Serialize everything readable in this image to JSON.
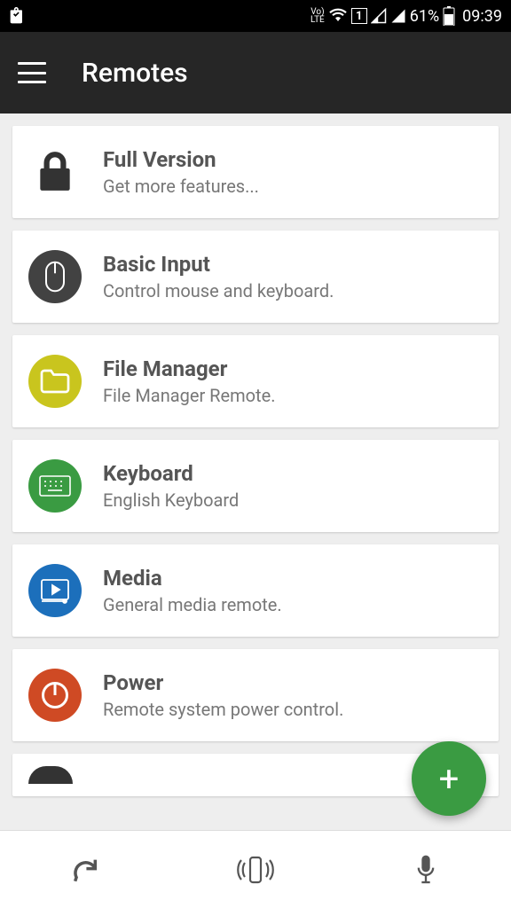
{
  "status": {
    "lte": "Vo)\nLTE",
    "sim": "1",
    "battery": "61%",
    "time": "09:39"
  },
  "header": {
    "title": "Remotes"
  },
  "remotes": [
    {
      "id": "full-version",
      "title": "Full Version",
      "subtitle": "Get more features...",
      "icon": "lock",
      "iconBg": "transparent",
      "iconPlain": true
    },
    {
      "id": "basic-input",
      "title": "Basic Input",
      "subtitle": "Control mouse and keyboard.",
      "icon": "mouse",
      "iconBg": "#424242"
    },
    {
      "id": "file-manager",
      "title": "File Manager",
      "subtitle": "File Manager Remote.",
      "icon": "folder",
      "iconBg": "#c9c51e"
    },
    {
      "id": "keyboard",
      "title": "Keyboard",
      "subtitle": "English Keyboard",
      "icon": "keyboard",
      "iconBg": "#3a9b42"
    },
    {
      "id": "media",
      "title": "Media",
      "subtitle": "General media remote.",
      "icon": "media",
      "iconBg": "#1c6fbb"
    },
    {
      "id": "power",
      "title": "Power",
      "subtitle": "Remote system power control.",
      "icon": "power",
      "iconBg": "#cf4a24"
    }
  ],
  "fab": {
    "label": "+"
  },
  "bottom": {
    "refresh": "refresh",
    "vibrate": "vibrate",
    "mic": "mic"
  }
}
